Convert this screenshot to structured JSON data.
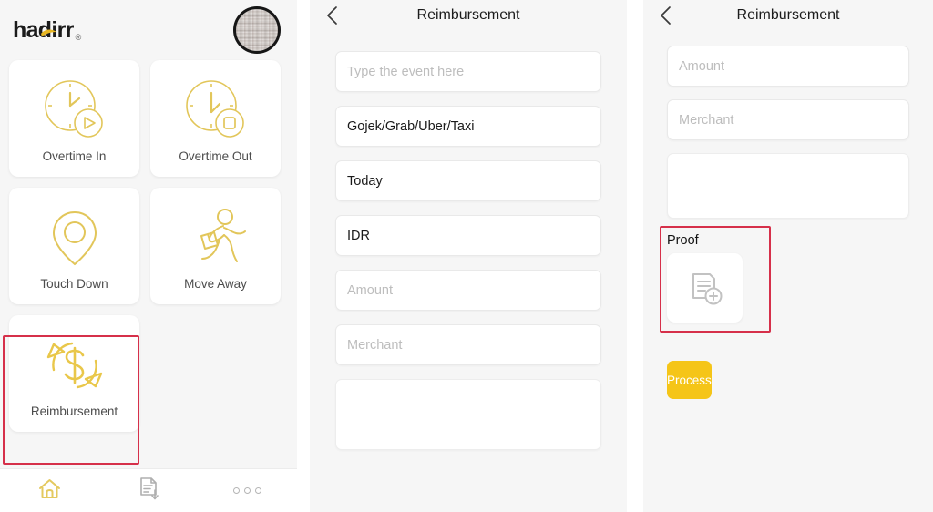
{
  "app": {
    "logo_text": "hadirr",
    "logo_trademark": "®",
    "accent_color": "#E8C33A",
    "button_color": "#F5C518",
    "highlight_color": "#D6304A"
  },
  "left_panel": {
    "avatar_name": "user-avatar",
    "tiles": [
      {
        "label": "Overtime In",
        "icon": "clock-play-icon"
      },
      {
        "label": "Overtime Out",
        "icon": "clock-stop-icon"
      },
      {
        "label": "Touch Down",
        "icon": "map-pin-icon"
      },
      {
        "label": "Move Away",
        "icon": "running-person-icon"
      },
      {
        "label": "Reimbursement",
        "icon": "money-refresh-icon"
      }
    ],
    "bottom_nav": [
      {
        "label": "Home",
        "icon": "home-icon",
        "active": true
      },
      {
        "label": "Reports",
        "icon": "document-down-icon",
        "active": false
      },
      {
        "label": "More",
        "icon": "more-dots-icon",
        "active": false
      }
    ]
  },
  "middle_panel": {
    "title": "Reimbursement",
    "back_icon": "chevron-left-icon",
    "fields": [
      {
        "name": "event",
        "value": "",
        "placeholder": "Type the event here"
      },
      {
        "name": "category",
        "value": "Gojek/Grab/Uber/Taxi",
        "placeholder": ""
      },
      {
        "name": "date",
        "value": "Today",
        "placeholder": ""
      },
      {
        "name": "currency",
        "value": "IDR",
        "placeholder": ""
      },
      {
        "name": "amount",
        "value": "",
        "placeholder": "Amount"
      },
      {
        "name": "merchant",
        "value": "",
        "placeholder": "Merchant"
      }
    ],
    "note": {
      "name": "description",
      "value": "",
      "placeholder": ""
    }
  },
  "right_panel": {
    "title": "Reimbursement",
    "back_icon": "chevron-left-icon",
    "fields": [
      {
        "name": "amount",
        "value": "",
        "placeholder": "Amount"
      },
      {
        "name": "merchant",
        "value": "",
        "placeholder": "Merchant"
      }
    ],
    "note": {
      "name": "description",
      "value": "",
      "placeholder": ""
    },
    "proof_label": "Proof",
    "proof_icon": "add-document-icon",
    "submit_label": "Process"
  }
}
